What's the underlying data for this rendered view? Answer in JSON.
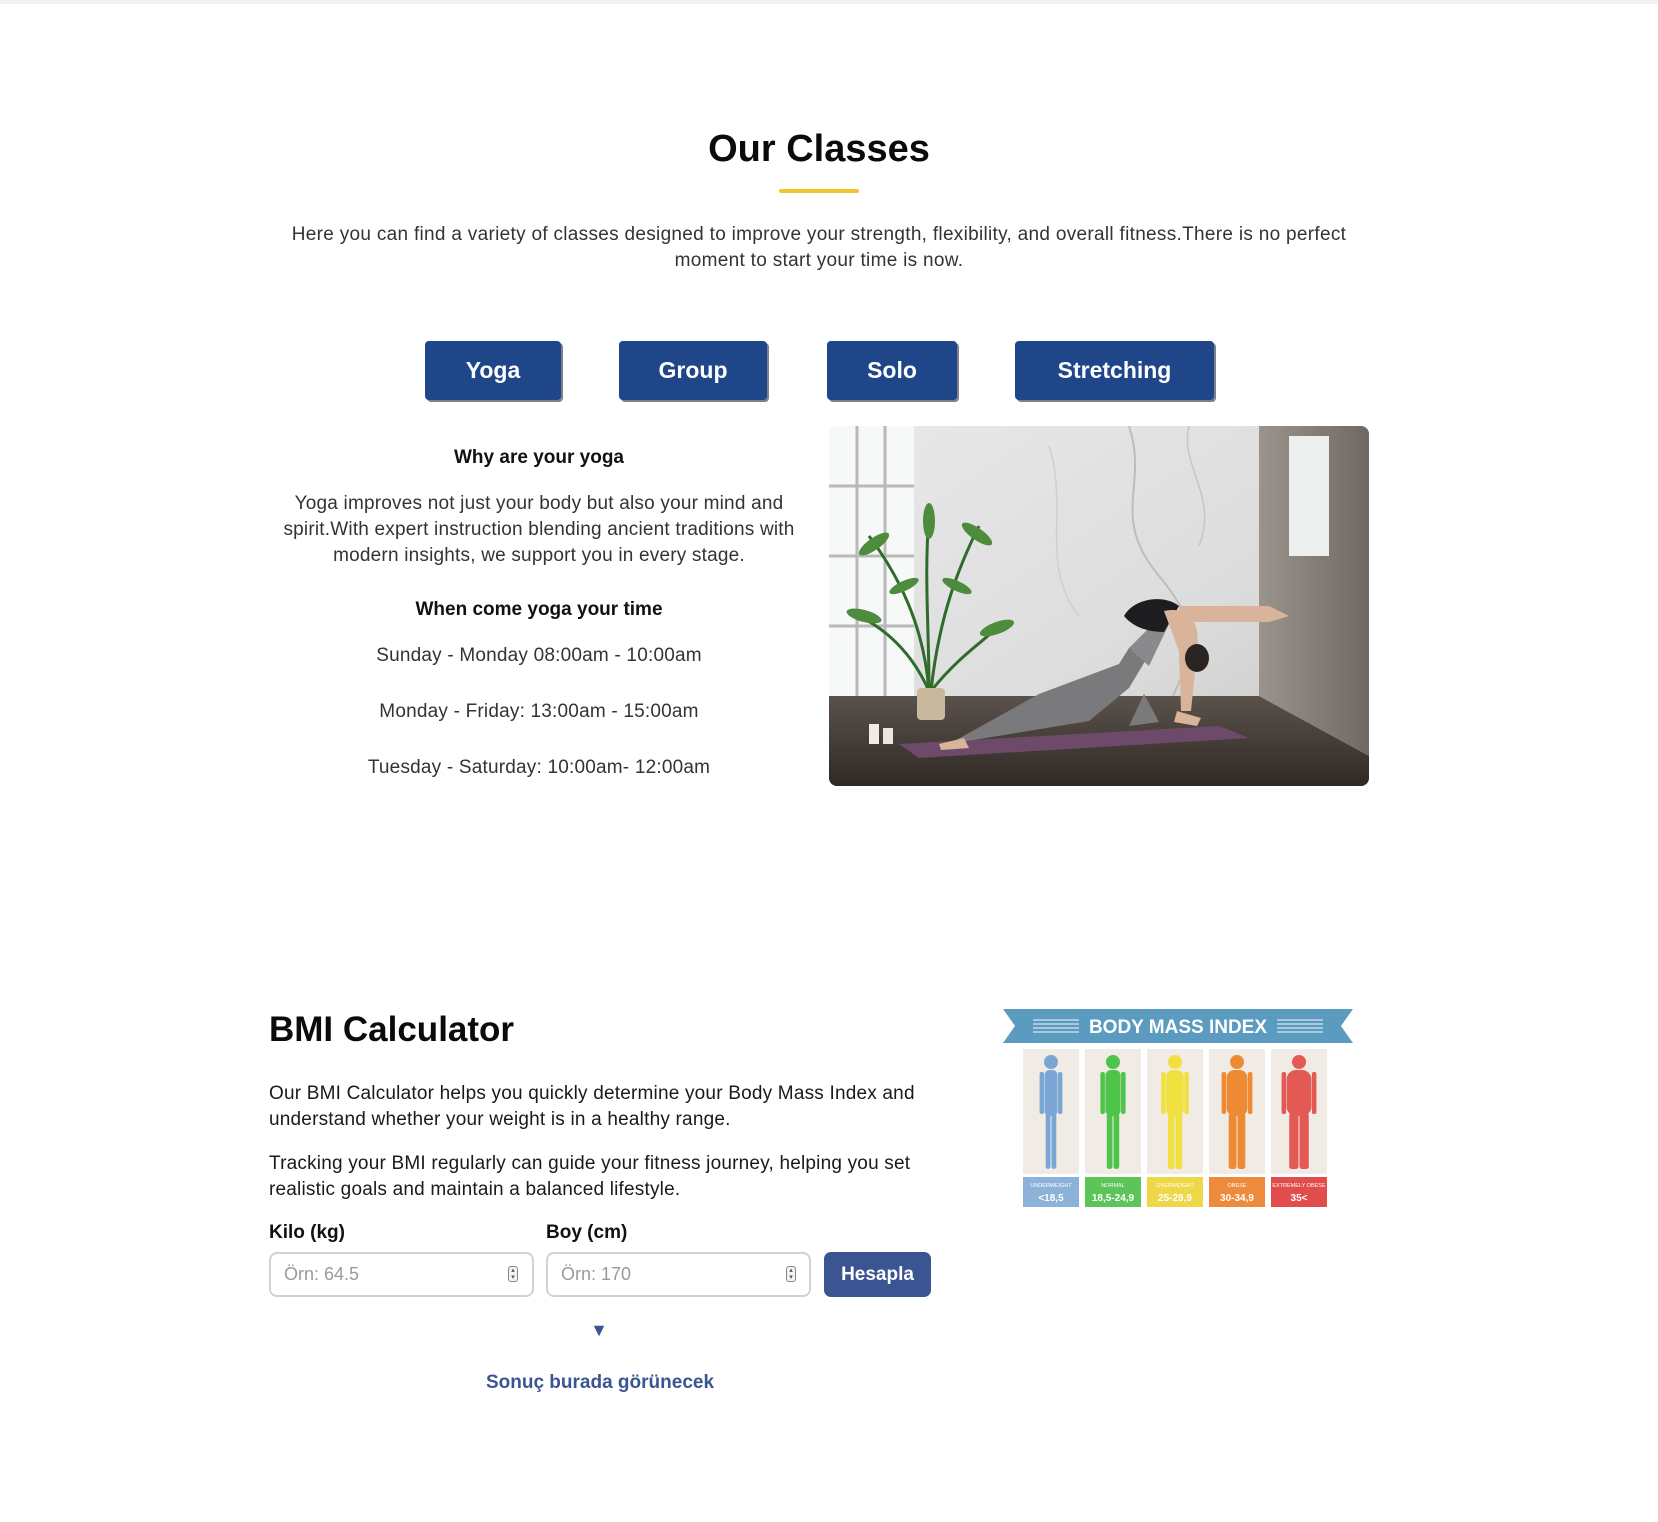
{
  "classes": {
    "title": "Our Classes",
    "intro": "Here you can find a variety of classes designed to improve your strength, flexibility, and overall fitness.There is no perfect moment to start your time is now.",
    "tabs": [
      {
        "label": "Yoga"
      },
      {
        "label": "Group"
      },
      {
        "label": "Solo"
      },
      {
        "label": "Stretching"
      }
    ],
    "panel": {
      "heading": "Why are your yoga",
      "description": "Yoga improves not just your body but also your mind and spirit.With expert instruction blending ancient traditions with modern insights, we support you in every stage.",
      "schedule_heading": "When come yoga your time",
      "schedule": [
        "Sunday - Monday 08:00am - 10:00am",
        "Monday - Friday: 13:00am - 15:00am",
        "Tuesday - Saturday: 10:00am- 12:00am"
      ]
    },
    "accent_color": "#f2c52e",
    "tab_color": "#1f4688"
  },
  "bmi": {
    "title": "BMI Calculator",
    "paragraph1": "Our BMI Calculator helps you quickly determine your Body Mass Index and understand whether your weight is in a healthy range.",
    "paragraph2": "Tracking your BMI regularly can guide your fitness journey, helping you set realistic goals and maintain a balanced lifestyle.",
    "weight_label": "Kilo (kg)",
    "weight_placeholder": "Örn: 64.5",
    "height_label": "Boy (cm)",
    "height_placeholder": "Örn: 170",
    "button_label": "Hesapla",
    "arrow": "▼",
    "result_text": "Sonuç burada görünecek",
    "accent_color": "#3b5593",
    "chart": {
      "banner": "BODY MASS INDEX",
      "categories": [
        {
          "name": "UNDERWEIGHT",
          "range": "<18,5",
          "color": "#7aa6d6",
          "label_bg": "#8db2da"
        },
        {
          "name": "NORMAL",
          "range": "18,5-24,9",
          "color": "#4fc44b",
          "label_bg": "#5dc45a"
        },
        {
          "name": "OVERWEIGHT",
          "range": "25-29,9",
          "color": "#f0e040",
          "label_bg": "#efd74a"
        },
        {
          "name": "OBESE",
          "range": "30-34,9",
          "color": "#ef8a34",
          "label_bg": "#ee8a3c"
        },
        {
          "name": "EXTREMELY OBESE",
          "range": "35<",
          "color": "#e35a55",
          "label_bg": "#e14d4d"
        }
      ]
    }
  }
}
